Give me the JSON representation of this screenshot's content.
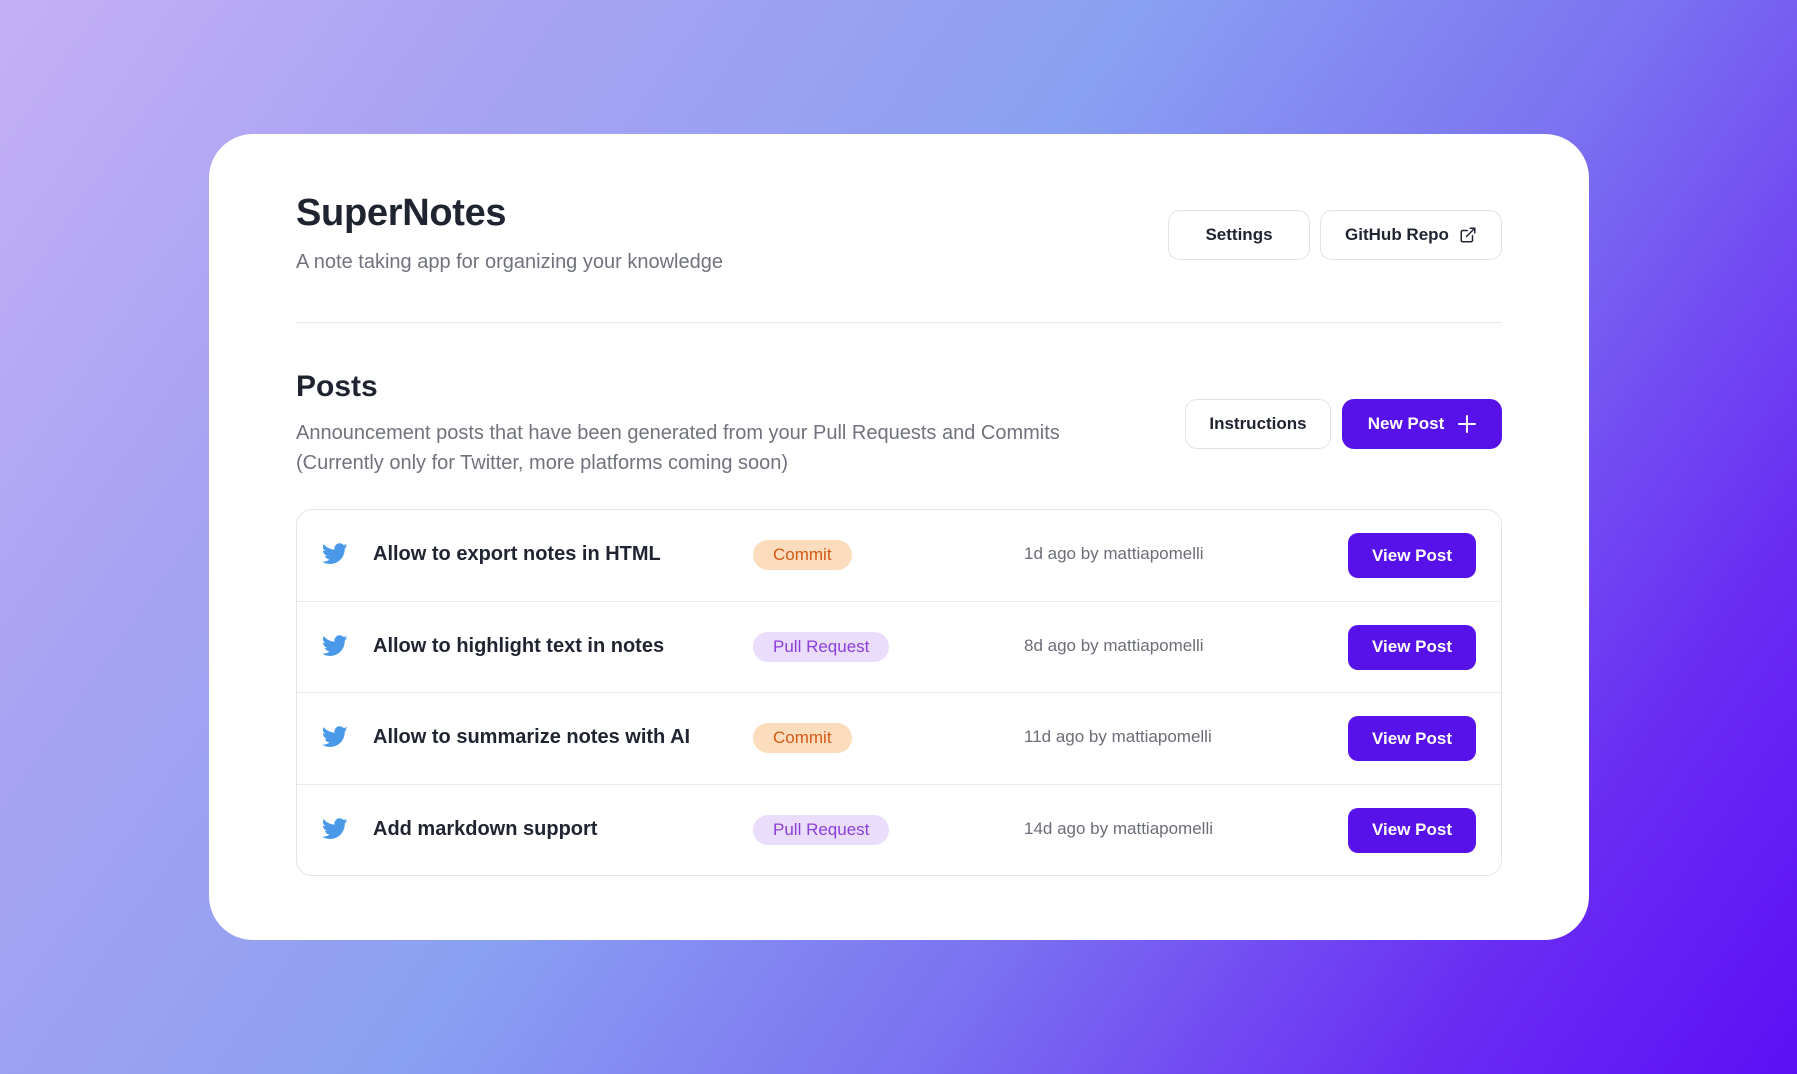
{
  "app": {
    "title": "SuperNotes",
    "subtitle": "A note taking app for organizing your knowledge"
  },
  "header": {
    "settings_label": "Settings",
    "github_label": "GitHub Repo",
    "github_icon": "external-link-icon"
  },
  "posts": {
    "title": "Posts",
    "description_line1": "Announcement posts that have been generated from your Pull Requests and Commits",
    "description_line2": "(Currently only for Twitter, more platforms coming soon)",
    "instructions_label": "Instructions",
    "new_post_label": "New Post",
    "new_post_icon": "plus-icon",
    "items": [
      {
        "icon": "twitter-icon",
        "title": "Allow to export notes in HTML",
        "type": "Commit",
        "meta": "1d ago by mattiapomelli",
        "action": "View Post"
      },
      {
        "icon": "twitter-icon",
        "title": "Allow to highlight text in notes",
        "type": "Pull Request",
        "meta": "8d ago by mattiapomelli",
        "action": "View Post"
      },
      {
        "icon": "twitter-icon",
        "title": "Allow to summarize notes with AI",
        "type": "Commit",
        "meta": "11d ago by mattiapomelli",
        "action": "View Post"
      },
      {
        "icon": "twitter-icon",
        "title": "Add markdown support",
        "type": "Pull Request",
        "meta": "14d ago by mattiapomelli",
        "action": "View Post"
      }
    ]
  },
  "colors": {
    "primary": "#5712ea",
    "twitter": "#4a99e9",
    "commit_bg": "#fbdcbc",
    "commit_text": "#d25a17",
    "pr_bg": "#eadcfb",
    "pr_text": "#8b3fd8"
  }
}
